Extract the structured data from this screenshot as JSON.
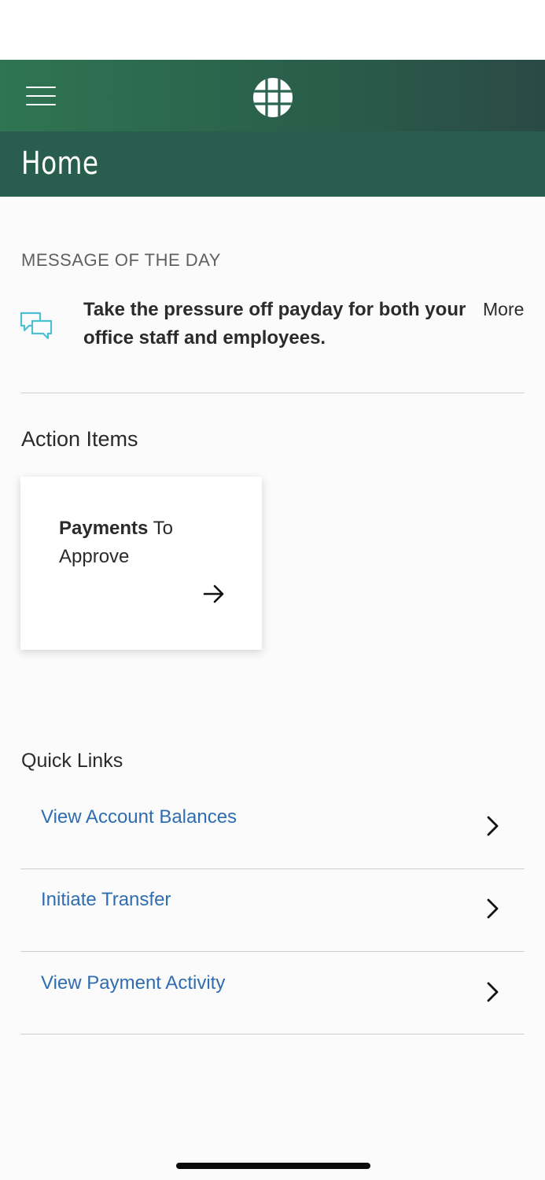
{
  "header": {
    "menu_icon": "hamburger-menu-icon",
    "logo_icon": "globe-grid-logo-icon",
    "page_title": "Home",
    "colors": {
      "header_gradient_start": "#2f7552",
      "header_gradient_end": "#2a4a45",
      "title_bar": "#295e4e"
    }
  },
  "message_of_the_day": {
    "heading": "MESSAGE OF THE DAY",
    "icon": "chat-bubbles-icon",
    "text": "Take the pressure off payday for both your office staff and employees.",
    "more_label": "More"
  },
  "action_items": {
    "heading": "Action Items",
    "cards": [
      {
        "title_bold": "Payments",
        "title_rest": " To Approve",
        "icon": "arrow-right-icon"
      }
    ]
  },
  "quick_links": {
    "heading": "Quick Links",
    "items": [
      {
        "label": "View Account Balances",
        "icon": "chevron-right-icon"
      },
      {
        "label": "Initiate Transfer",
        "icon": "chevron-right-icon"
      },
      {
        "label": "View Payment Activity",
        "icon": "chevron-right-icon"
      }
    ],
    "link_color": "#2f6db0"
  }
}
